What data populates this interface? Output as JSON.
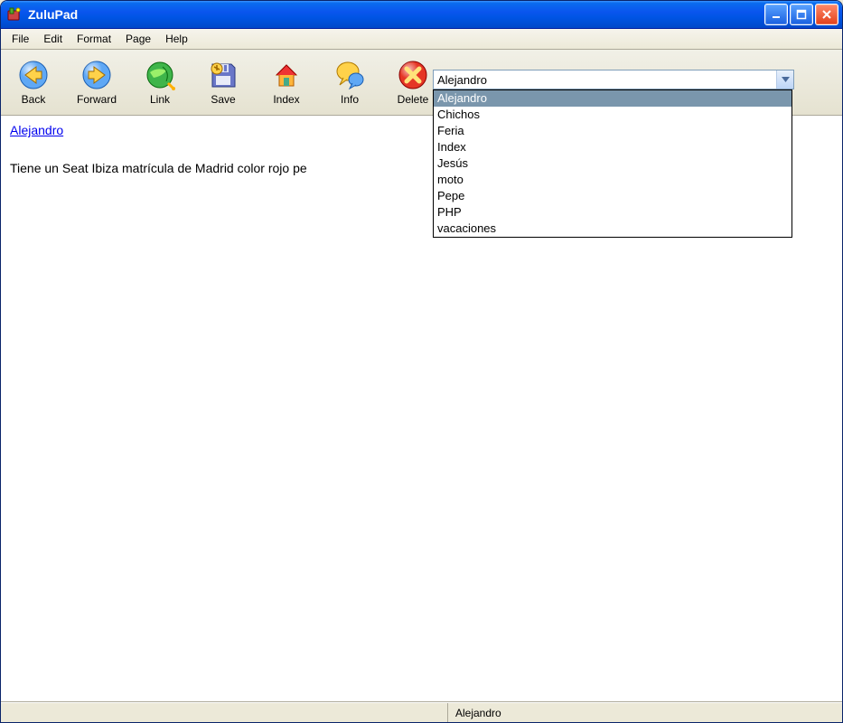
{
  "app": {
    "title": "ZuluPad"
  },
  "menu": {
    "items": [
      "File",
      "Edit",
      "Format",
      "Page",
      "Help"
    ]
  },
  "toolbar": {
    "buttons": [
      {
        "label": "Back",
        "icon": "arrow-left"
      },
      {
        "label": "Forward",
        "icon": "arrow-right"
      },
      {
        "label": "Link",
        "icon": "link-globe"
      },
      {
        "label": "Save",
        "icon": "floppy"
      },
      {
        "label": "Index",
        "icon": "home"
      },
      {
        "label": "Info",
        "icon": "info-bubble"
      },
      {
        "label": "Delete",
        "icon": "delete-x"
      }
    ]
  },
  "combo": {
    "value": "Alejandro",
    "options": [
      "Alejandro",
      "Chichos",
      "Feria",
      "Index",
      "Jesús",
      "moto",
      "Pepe",
      "PHP",
      "vacaciones"
    ],
    "selected_index": 0
  },
  "page": {
    "link_text": "Alejandro",
    "body": "Tiene un Seat Ibiza matrícula de Madrid color rojo pe"
  },
  "statusbar": {
    "text": "Alejandro"
  },
  "colors": {
    "titlebar_blue": "#0a55ee",
    "close_red": "#e2401a",
    "link_blue": "#0000ee"
  }
}
